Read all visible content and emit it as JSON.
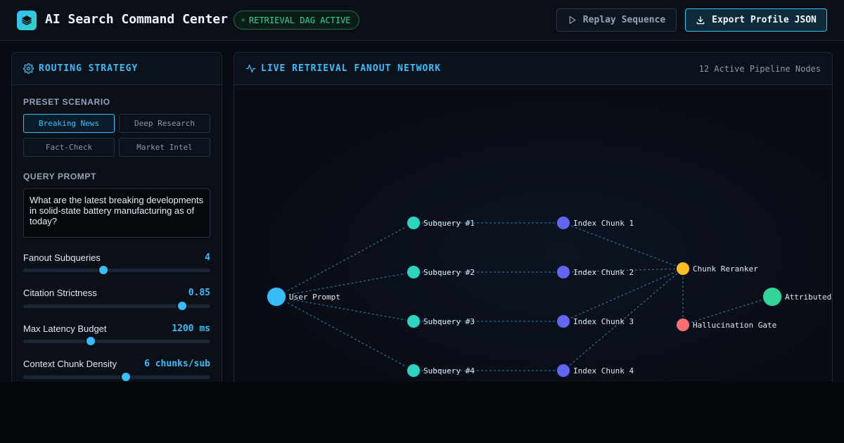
{
  "header": {
    "title": "AI Search Command Center",
    "status_badge": "RETRIEVAL DAG ACTIVE",
    "replay_label": "Replay Sequence",
    "export_label": "Export Profile JSON"
  },
  "sidebar": {
    "title": "ROUTING STRATEGY",
    "preset_label": "PRESET SCENARIO",
    "presets": [
      {
        "label": "Breaking News",
        "active": true
      },
      {
        "label": "Deep Research",
        "active": false
      },
      {
        "label": "Fact-Check",
        "active": false
      },
      {
        "label": "Market Intel",
        "active": false
      }
    ],
    "query_label": "QUERY PROMPT",
    "query_value": "What are the latest breaking developments in solid-state battery manufacturing as of today?",
    "sliders": [
      {
        "label": "Fanout Subqueries",
        "value": "4",
        "level": 0.43
      },
      {
        "label": "Citation Strictness",
        "value": "0.85",
        "level": 0.85
      },
      {
        "label": "Max Latency Budget",
        "value": "1200 ms",
        "level": 0.36
      },
      {
        "label": "Context Chunk Density",
        "value": "6 chunks/sub",
        "level": 0.55
      }
    ]
  },
  "network": {
    "title": "LIVE RETRIEVAL FANOUT NETWORK",
    "node_count": "12 Active Pipeline Nodes",
    "colors": {
      "prompt": "#38bdf8",
      "subquery": "#2dd4bf",
      "chunk": "#6366f1",
      "reranker": "#fbbf24",
      "gate": "#f87171",
      "output": "#34d399",
      "edge": "#2b6a86"
    },
    "nodes": [
      {
        "id": "prompt",
        "label": "User Prompt",
        "kind": "prompt"
      },
      {
        "id": "sq1",
        "label": "Subquery #1",
        "kind": "subquery"
      },
      {
        "id": "sq2",
        "label": "Subquery #2",
        "kind": "subquery"
      },
      {
        "id": "sq3",
        "label": "Subquery #3",
        "kind": "subquery"
      },
      {
        "id": "sq4",
        "label": "Subquery #4",
        "kind": "subquery"
      },
      {
        "id": "ch1",
        "label": "Index Chunk 1",
        "kind": "chunk"
      },
      {
        "id": "ch2",
        "label": "Index Chunk 2",
        "kind": "chunk"
      },
      {
        "id": "ch3",
        "label": "Index Chunk 3",
        "kind": "chunk"
      },
      {
        "id": "ch4",
        "label": "Index Chunk 4",
        "kind": "chunk"
      },
      {
        "id": "rerank",
        "label": "Chunk Reranker",
        "kind": "reranker"
      },
      {
        "id": "gate",
        "label": "Hallucination Gate",
        "kind": "gate"
      },
      {
        "id": "out",
        "label": "Attributed",
        "kind": "output"
      }
    ],
    "edges": [
      [
        "prompt",
        "sq1"
      ],
      [
        "prompt",
        "sq2"
      ],
      [
        "prompt",
        "sq3"
      ],
      [
        "prompt",
        "sq4"
      ],
      [
        "sq1",
        "ch1"
      ],
      [
        "sq2",
        "ch2"
      ],
      [
        "sq3",
        "ch3"
      ],
      [
        "sq4",
        "ch4"
      ],
      [
        "ch1",
        "rerank"
      ],
      [
        "ch2",
        "rerank"
      ],
      [
        "ch3",
        "rerank"
      ],
      [
        "ch4",
        "rerank"
      ],
      [
        "rerank",
        "gate"
      ],
      [
        "gate",
        "out"
      ]
    ]
  }
}
